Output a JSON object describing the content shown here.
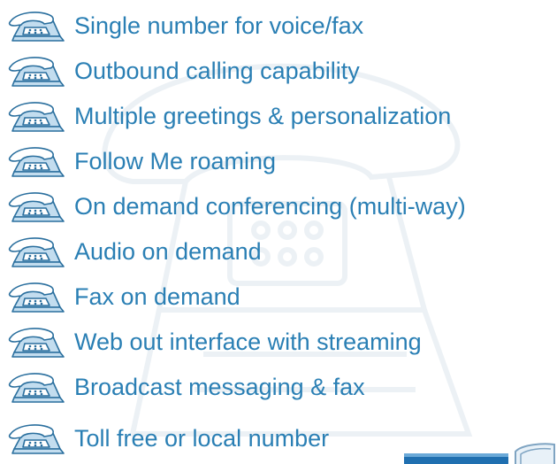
{
  "features": [
    {
      "label": "Single number for voice/fax",
      "icon": "telephone-icon"
    },
    {
      "label": "Outbound calling capability",
      "icon": "telephone-icon"
    },
    {
      "label": "Multiple greetings & personalization",
      "icon": "telephone-icon"
    },
    {
      "label": "Follow Me roaming",
      "icon": "telephone-icon"
    },
    {
      "label": "On demand conferencing (multi-way)",
      "icon": "telephone-icon"
    },
    {
      "label": "Audio on demand",
      "icon": "telephone-icon"
    },
    {
      "label": "Fax on demand",
      "icon": "telephone-icon"
    },
    {
      "label": "Web out interface with streaming",
      "icon": "telephone-icon"
    },
    {
      "label": "Broadcast messaging & fax",
      "icon": "telephone-icon"
    },
    {
      "label": "Toll free or local number",
      "icon": "telephone-icon"
    }
  ],
  "colors": {
    "text": "#2a7fb4",
    "icon_fill": "#c3ddef",
    "icon_stroke": "#2a6f9e"
  }
}
